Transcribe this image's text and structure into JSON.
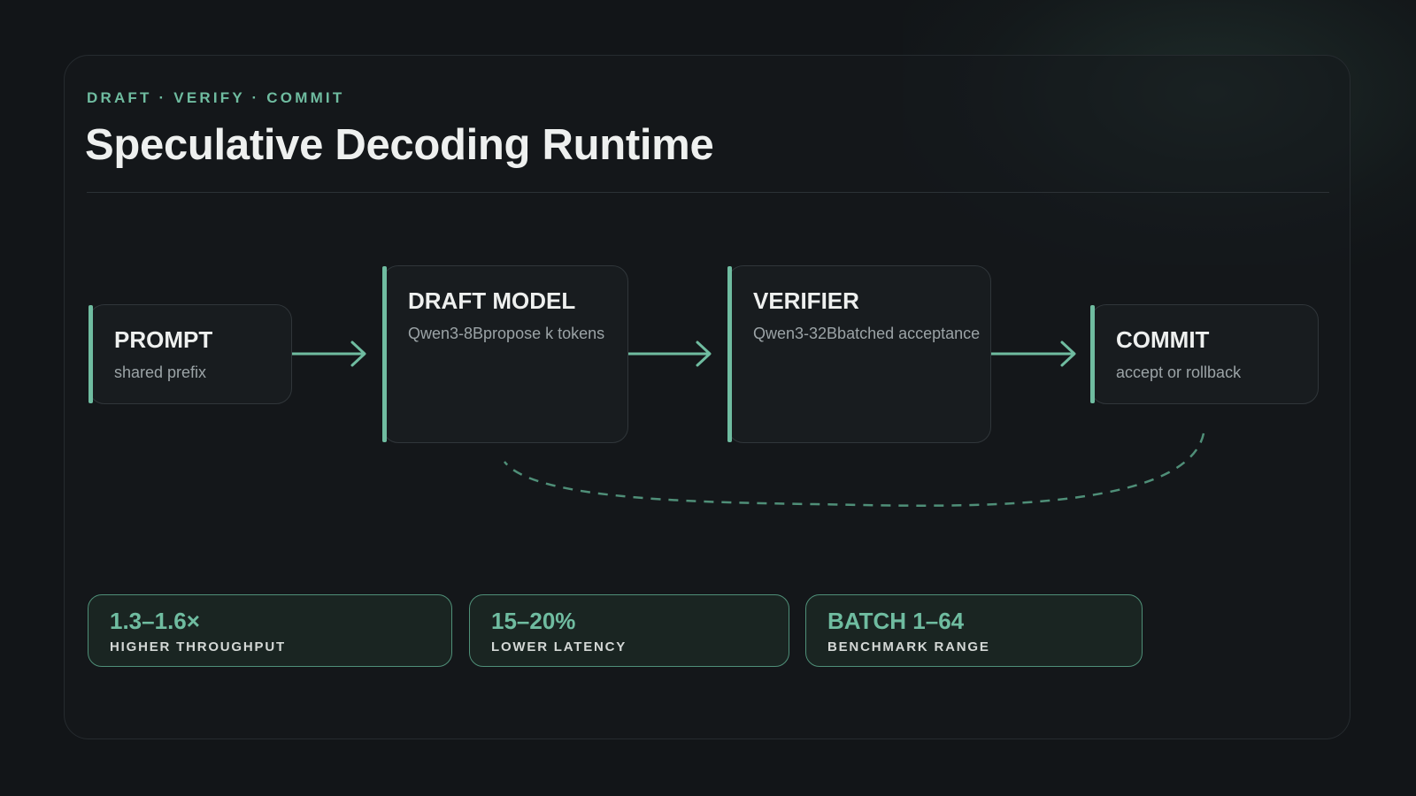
{
  "header": {
    "eyebrow": "DRAFT · VERIFY · COMMIT",
    "title": "Speculative Decoding Runtime"
  },
  "pipeline": [
    {
      "title": "PROMPT",
      "subtitle": "shared prefix"
    },
    {
      "title": "DRAFT MODEL",
      "subtitle": "Qwen3-8Bpropose k tokens"
    },
    {
      "title": "VERIFIER",
      "subtitle": "Qwen3-32Bbatched acceptance"
    },
    {
      "title": "COMMIT",
      "subtitle": "accept or rollback"
    }
  ],
  "metrics": [
    {
      "value": "1.3–1.6×",
      "label": "HIGHER THROUGHPUT"
    },
    {
      "value": "15–20%",
      "label": "LOWER LATENCY"
    },
    {
      "value": "BATCH 1–64",
      "label": "BENCHMARK RANGE"
    }
  ],
  "colors": {
    "accent": "#6fbca0",
    "background": "#121518",
    "node_fill": "#181c1f",
    "metric_fill": "#1a2522"
  }
}
